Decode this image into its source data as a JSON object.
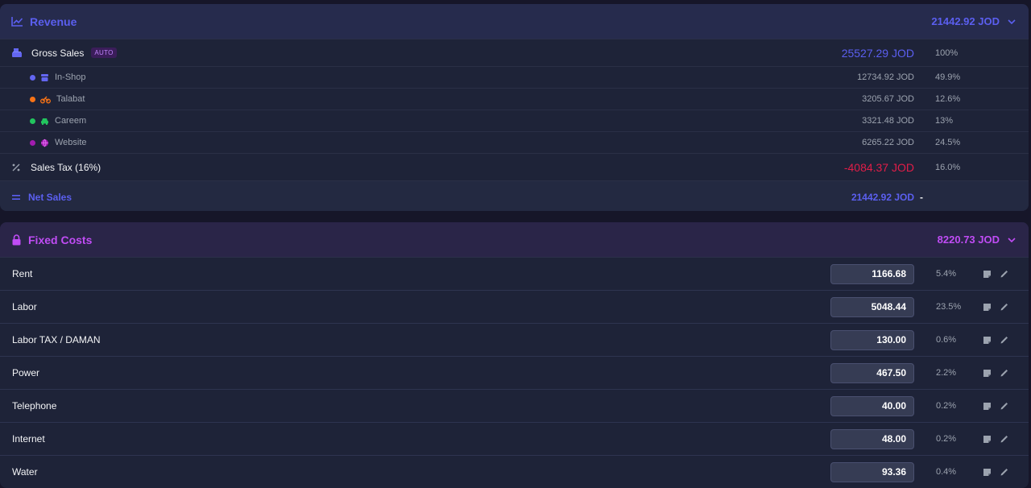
{
  "colors": {
    "revenue_accent": "#5b5ff0",
    "fixed_accent": "#c04cf5",
    "negative": "#e11d48",
    "in_shop": "#6366f1",
    "talabat": "#f97316",
    "careem": "#22c55e",
    "website": "#a21caf"
  },
  "revenue": {
    "title": "Revenue",
    "total": "21442.92 JOD",
    "gross": {
      "label": "Gross Sales",
      "badge": "AUTO",
      "value": "25527.29 JOD",
      "pct": "100%"
    },
    "channels": [
      {
        "name": "In-Shop",
        "icon": "store-icon",
        "value": "12734.92 JOD",
        "pct": "49.9%"
      },
      {
        "name": "Talabat",
        "icon": "motorcycle-icon",
        "value": "3205.67 JOD",
        "pct": "12.6%"
      },
      {
        "name": "Careem",
        "icon": "car-icon",
        "value": "3321.48 JOD",
        "pct": "13%"
      },
      {
        "name": "Website",
        "icon": "globe-icon",
        "value": "6265.22 JOD",
        "pct": "24.5%"
      }
    ],
    "tax": {
      "label": "Sales Tax (16%)",
      "value": "-4084.37 JOD",
      "pct": "16.0%"
    },
    "net": {
      "label": "Net Sales",
      "value": "21442.92 JOD",
      "suffix": "-"
    }
  },
  "fixed": {
    "title": "Fixed Costs",
    "total": "8220.73 JOD",
    "items": [
      {
        "label": "Rent",
        "value": "1166.68",
        "pct": "5.4%"
      },
      {
        "label": "Labor",
        "value": "5048.44",
        "pct": "23.5%"
      },
      {
        "label": "Labor TAX / DAMAN",
        "value": "130.00",
        "pct": "0.6%"
      },
      {
        "label": "Power",
        "value": "467.50",
        "pct": "2.2%"
      },
      {
        "label": "Telephone",
        "value": "40.00",
        "pct": "0.2%"
      },
      {
        "label": "Internet",
        "value": "48.00",
        "pct": "0.2%"
      },
      {
        "label": "Water",
        "value": "93.36",
        "pct": "0.4%"
      }
    ]
  }
}
